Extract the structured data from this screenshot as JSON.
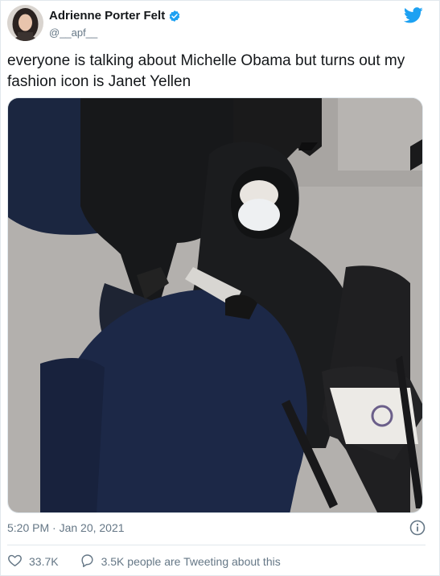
{
  "author": {
    "display_name": "Adrienne Porter Felt",
    "handle": "@__apf__"
  },
  "icons": {
    "verified": "verified-badge-icon",
    "brand": "twitter-bird-icon",
    "info": "info-icon",
    "like": "heart-icon",
    "reply": "speech-bubble-icon"
  },
  "tweet": {
    "text": "everyone is talking about Michelle Obama but turns out my fashion icon is Janet Yellen",
    "timestamp": "5:20 PM · Jan 20, 2021"
  },
  "actions": {
    "likes": "33.7K",
    "replies_label": "3.5K people are Tweeting about this"
  },
  "colors": {
    "brand": "#1da1f2",
    "muted": "#657786",
    "text": "#14171a",
    "border": "#e1e8ed"
  }
}
